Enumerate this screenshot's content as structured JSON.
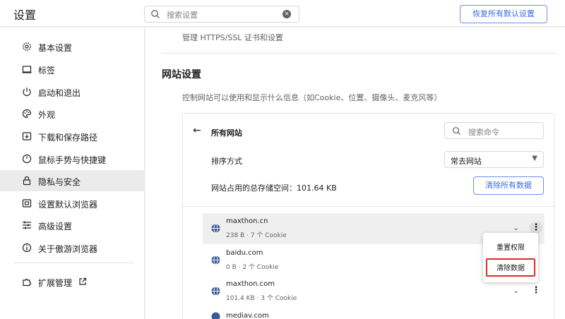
{
  "header": {
    "title": "设置",
    "search_placeholder": "搜索设置",
    "reset_button": "恢复所有默认设置"
  },
  "sidebar": {
    "items": [
      {
        "label": "基本设置",
        "icon": "gear-icon"
      },
      {
        "label": "标签",
        "icon": "tab-icon"
      },
      {
        "label": "启动和退出",
        "icon": "power-icon"
      },
      {
        "label": "外观",
        "icon": "palette-icon"
      },
      {
        "label": "下载和保存路径",
        "icon": "download-icon"
      },
      {
        "label": "鼠标手势与快捷键",
        "icon": "mouse-icon"
      },
      {
        "label": "隐私与安全",
        "icon": "lock-icon",
        "active": true
      },
      {
        "label": "设置默认浏览器",
        "icon": "browser-icon"
      },
      {
        "label": "高级设置",
        "icon": "sliders-icon"
      },
      {
        "label": "关于傲游浏览器",
        "icon": "info-icon"
      }
    ],
    "extensions": {
      "label": "扩展管理",
      "icon": "puzzle-icon",
      "external_icon": "external-link-icon"
    }
  },
  "main": {
    "ssl_text": "管理 HTTPS/SSL 证书和设置",
    "section_title": "网站设置",
    "section_desc": "控制网站可以使用和显示什么信息（如Cookie、位置、摄像头、麦克风等）",
    "card": {
      "title": "所有网站",
      "search_placeholder": "搜索命令",
      "sort_label": "排序方式",
      "sort_value": "常去网站",
      "storage_text": "网站占用的总存储空间：101.64 KB",
      "clear_all_button": "清除所有数据",
      "sites": [
        {
          "name": "maxthon.cn",
          "meta": "238 B · 7 个 Cookie"
        },
        {
          "name": "baidu.com",
          "meta": "0 B · 2 个 Cookie"
        },
        {
          "name": "maxthon.com",
          "meta": "101.4 KB · 3 个 Cookie"
        },
        {
          "name": "mediav.com",
          "meta": ""
        }
      ]
    }
  },
  "context_menu": {
    "reset_permissions": "重置权限",
    "clear_data": "清除数据"
  },
  "colors": {
    "accent": "#3b6ce0",
    "highlight_border": "#d93025",
    "active_nav_bg": "#ebebeb"
  }
}
